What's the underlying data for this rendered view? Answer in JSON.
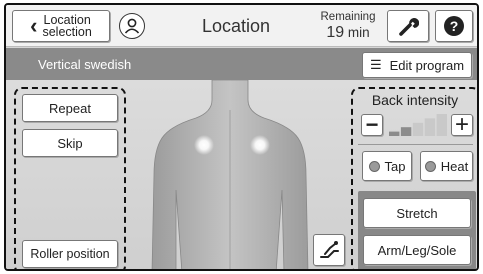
{
  "header": {
    "back_label": "Location\nselection",
    "title": "Location",
    "remaining_label": "Remaining",
    "remaining_value": "19",
    "remaining_unit": "min",
    "icons": {
      "user": "user-icon",
      "wrench": "wrench-icon",
      "help": "help-icon"
    }
  },
  "program": {
    "name": "Vertical swedish",
    "edit_label": "Edit program"
  },
  "left_panel": {
    "repeat_label": "Repeat",
    "skip_label": "Skip",
    "roller_label": "Roller position"
  },
  "right_panel": {
    "intensity_title": "Back intensity",
    "minus_label": "−",
    "plus_label": "+",
    "intensity_levels": 5,
    "intensity_level": 0.4,
    "tap_label": "Tap",
    "heat_label": "Heat",
    "stretch_label": "Stretch",
    "arm_label": "Arm/Leg/Sole"
  },
  "colors": {
    "program_bar": "#8a8a8a",
    "background": "#d6d6d6",
    "heat_spot": "#ffffff"
  }
}
